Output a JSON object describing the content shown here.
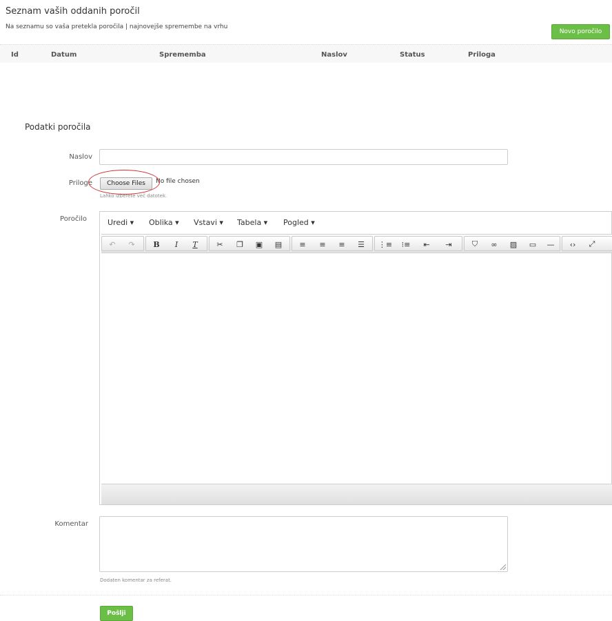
{
  "header": {
    "title": "Seznam vaših oddanih poročil",
    "subtitle": "Na seznamu so vaša pretekla poročila | najnovejše spremembe na vrhu",
    "new_report_label": "Novo poročilo"
  },
  "table": {
    "columns": [
      "Id",
      "Datum",
      "Sprememba",
      "Naslov",
      "Status",
      "Priloga"
    ]
  },
  "form": {
    "section_title": "Podatki poročila",
    "title_label": "Naslov",
    "title_value": "",
    "attachments_label": "Priloge",
    "choose_files_label": "Choose Files",
    "no_file_text": "No file chosen",
    "attachments_help": "Lahko izberete več datotek.",
    "report_label": "Poročilo",
    "comment_label": "Komentar",
    "comment_value": "",
    "comment_help": "Dodaten komentar za referat.",
    "submit_label": "Pošlji"
  },
  "editor": {
    "menus": [
      "Uredi ▾",
      "Oblika ▾",
      "Vstavi ▾",
      "Tabela ▾",
      "Pogled ▾"
    ],
    "toolbar_icons": [
      "undo-icon",
      "redo-icon",
      "bold-icon",
      "italic-icon",
      "clear-format-icon",
      "cut-icon",
      "copy-icon",
      "paste-icon",
      "paste-text-icon",
      "align-left-icon",
      "align-center-icon",
      "align-right-icon",
      "align-justify-icon",
      "bullet-list-icon",
      "numbered-list-icon",
      "outdent-icon",
      "indent-icon",
      "bookmark-icon",
      "link-icon",
      "image-icon",
      "media-icon",
      "hr-icon",
      "code-icon",
      "fullscreen-icon"
    ]
  },
  "colors": {
    "accent_green": "#6bbf47",
    "annotation_red": "#cc3333"
  }
}
